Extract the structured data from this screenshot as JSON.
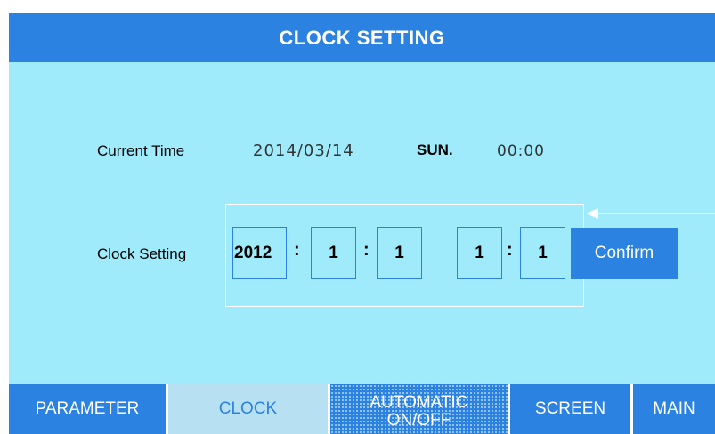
{
  "header": {
    "title": "CLOCK SETTING"
  },
  "current_time": {
    "label": "Current Time",
    "date": "2014/03/14",
    "weekday": "SUN.",
    "time": "00:00"
  },
  "clock_setting": {
    "label": "Clock Setting",
    "year": "2012",
    "month": "1",
    "day": "1",
    "hour": "1",
    "minute": "1",
    "separator": ":",
    "confirm_label": "Confirm"
  },
  "tabs": [
    {
      "label": "PARAMETER"
    },
    {
      "label": "CLOCK"
    },
    {
      "label_line1": "AUTOMATIC",
      "label_line2": "ON/OFF"
    },
    {
      "label": "SCREEN"
    },
    {
      "label": "MAIN"
    }
  ],
  "colors": {
    "accent": "#2c82e0",
    "panel": "#9feafb",
    "active_tab": "#b7e1f3"
  }
}
